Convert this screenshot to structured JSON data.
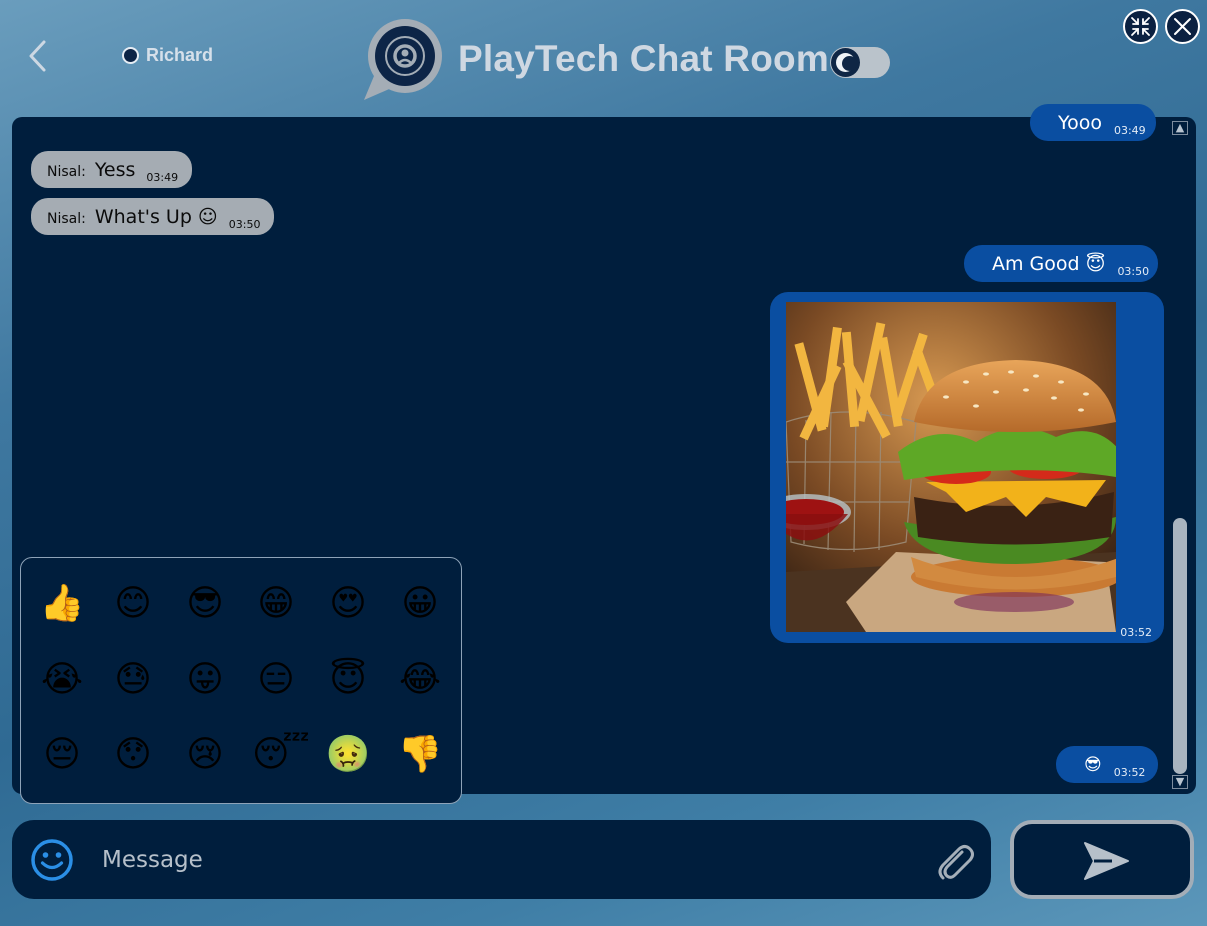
{
  "header": {
    "title": "PlayTech Chat Room",
    "user_name": "Richard",
    "back_icon": "chevron-left-icon",
    "logo_icon": "chat-bubble-logo-icon",
    "theme_icon": "moon-icon",
    "minimize_icon": "compress-arrows-icon",
    "close_icon": "close-icon"
  },
  "messages": [
    {
      "direction": "outgoing",
      "text": "Yooo",
      "time": "03:49"
    },
    {
      "direction": "incoming",
      "sender": "Nisal:",
      "text": "Yess",
      "time": "03:49"
    },
    {
      "direction": "incoming",
      "sender": "Nisal:",
      "text": "What's Up ☺",
      "time": "03:50"
    },
    {
      "direction": "outgoing",
      "text": "Am Good 😇",
      "time": "03:50"
    },
    {
      "direction": "outgoing",
      "type": "image",
      "image_subject": "burger with fries",
      "time": "03:52"
    },
    {
      "direction": "outgoing",
      "text": "😎",
      "time": "03:52"
    }
  ],
  "emoji_picker": {
    "rows": [
      [
        "👍",
        "😊",
        "😎",
        "😁",
        "😍",
        "😀"
      ],
      [
        "😭",
        "😓",
        "😛",
        "😑",
        "😇",
        "😂"
      ],
      [
        "😔",
        "😯",
        "😢",
        "😴",
        "🤢",
        "👎"
      ]
    ]
  },
  "composer": {
    "placeholder": "Message",
    "emoji_icon": "smiley-icon",
    "attach_icon": "paperclip-icon",
    "send_icon": "send-arrow-icon"
  },
  "colors": {
    "panel_bg": "#001e3d",
    "outgoing_bubble": "#0a4ea1",
    "incoming_bubble": "#a5acb3",
    "accent": "#2b8fe6"
  }
}
